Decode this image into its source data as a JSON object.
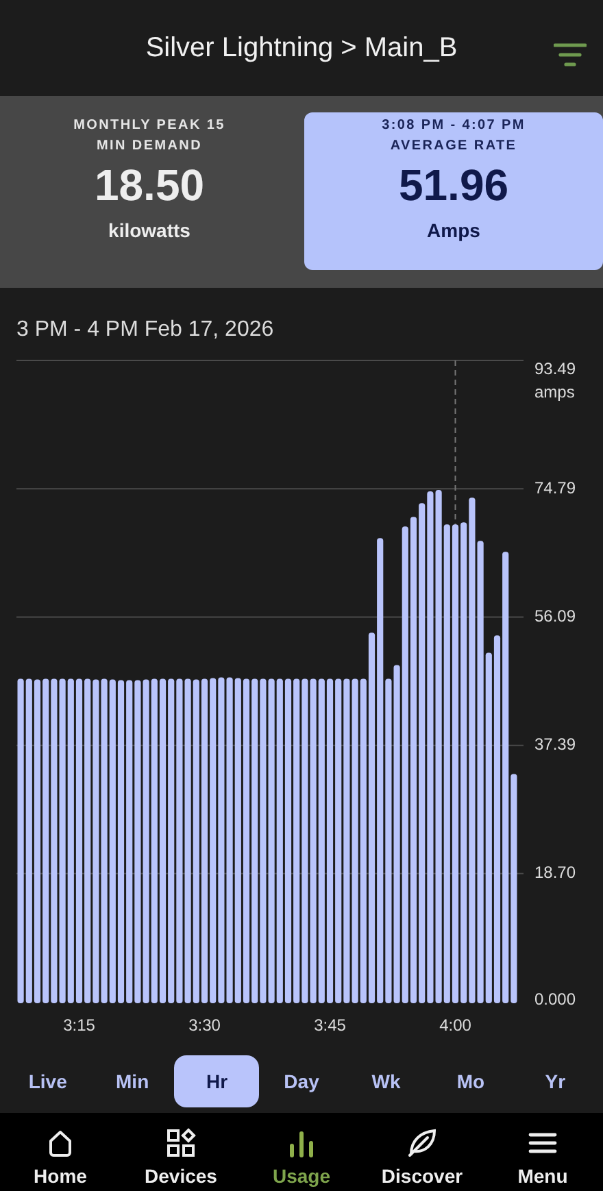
{
  "header": {
    "title": "Silver Lightning > Main_B"
  },
  "summary_cards": [
    {
      "label": "MONTHLY PEAK 15 MIN DEMAND",
      "value": "18.50",
      "unit": "kilowatts",
      "highlighted": false
    },
    {
      "subtitle": "3:08 PM - 4:07 PM",
      "label": "AVERAGE RATE",
      "value": "51.96",
      "unit": "Amps",
      "highlighted": true
    }
  ],
  "chart": {
    "range_label": "3 PM - 4 PM Feb 17, 2026",
    "chart_data": {
      "type": "bar",
      "ylabel": "amps",
      "categories": [
        null,
        null,
        null,
        null,
        null,
        null,
        null,
        "3:15",
        null,
        null,
        null,
        null,
        null,
        null,
        null,
        null,
        null,
        null,
        null,
        null,
        null,
        null,
        "3:30",
        null,
        null,
        null,
        null,
        null,
        null,
        null,
        null,
        null,
        null,
        null,
        null,
        null,
        null,
        "3:45",
        null,
        null,
        null,
        null,
        null,
        null,
        null,
        null,
        null,
        null,
        null,
        null,
        null,
        null,
        "4:00",
        null,
        null,
        null,
        null,
        null,
        null,
        null
      ],
      "grid": true,
      "series": [
        {
          "color": "#b9c4fb",
          "values": [
            47.1,
            47.1,
            47.0,
            47.1,
            47.1,
            47.1,
            47.1,
            47.1,
            47.1,
            47.0,
            47.1,
            47.0,
            46.9,
            46.9,
            46.9,
            47.0,
            47.1,
            47.1,
            47.1,
            47.1,
            47.1,
            47.0,
            47.1,
            47.2,
            47.3,
            47.3,
            47.2,
            47.1,
            47.1,
            47.1,
            47.1,
            47.1,
            47.1,
            47.1,
            47.1,
            47.1,
            47.1,
            47.1,
            47.1,
            47.1,
            47.1,
            47.1,
            53.8,
            67.6,
            47.1,
            49.1,
            69.3,
            70.7,
            72.7,
            74.4,
            74.6,
            69.6,
            69.6,
            69.9,
            73.5,
            67.2,
            50.9,
            53.4,
            65.6,
            33.2
          ]
        }
      ],
      "ylim": [
        0,
        93.49
      ],
      "yticks": [
        {
          "value": 0,
          "label": "0.000"
        },
        {
          "value": 18.7,
          "label": "18.70"
        },
        {
          "value": 37.39,
          "label": "37.39"
        },
        {
          "value": 56.09,
          "label": "56.09"
        },
        {
          "value": 74.79,
          "label": "74.79"
        },
        {
          "value": 93.49,
          "label": "93.49"
        }
      ],
      "ref_lines": [
        {
          "axis": "x",
          "value": "4:00"
        }
      ]
    }
  },
  "period_tabs": [
    {
      "label": "Live",
      "selected": false
    },
    {
      "label": "Min",
      "selected": false
    },
    {
      "label": "Hr",
      "selected": true
    },
    {
      "label": "Day",
      "selected": false
    },
    {
      "label": "Wk",
      "selected": false
    },
    {
      "label": "Mo",
      "selected": false
    },
    {
      "label": "Yr",
      "selected": false
    }
  ],
  "bottom_nav": [
    {
      "label": "Home",
      "selected": false
    },
    {
      "label": "Devices",
      "selected": false
    },
    {
      "label": "Usage",
      "selected": true
    },
    {
      "label": "Discover",
      "selected": false
    },
    {
      "label": "Menu",
      "selected": false
    }
  ]
}
